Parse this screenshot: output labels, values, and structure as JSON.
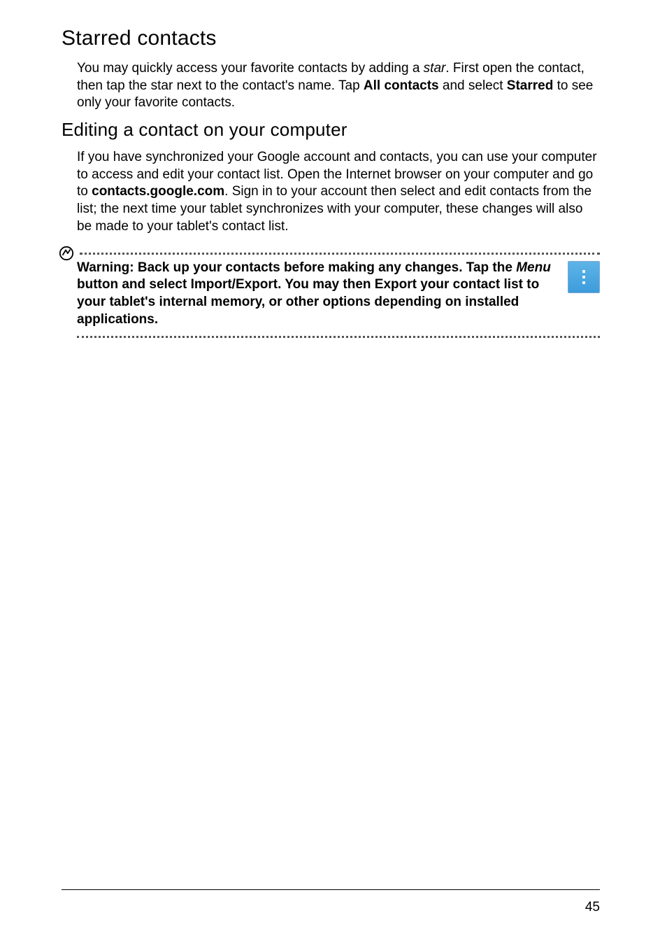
{
  "section1": {
    "heading": "Starred contacts",
    "p1_a": "You may quickly access your favorite contacts by adding a ",
    "p1_star": "star",
    "p1_b": ". First open the contact, then tap the star next to the contact's name. Tap ",
    "p1_all": "All contacts",
    "p1_c": "  and select ",
    "p1_starred": "Starred",
    "p1_d": " to see only your favorite contacts."
  },
  "section2": {
    "heading": "Editing a contact on your computer",
    "p1_a": "If you have synchronized your Google account and contacts, you can use your computer to access and edit your contact list. Open the Internet browser on your computer and go to ",
    "p1_url": "contacts.google.com",
    "p1_b": ". Sign in to your account then select and edit contacts from the list; the next time your tablet synchronizes with your computer, these changes will also be made to your tablet's contact list."
  },
  "warning": {
    "t1": "Warning: Back up your contacts before making any changes. Tap the ",
    "menu": "Menu",
    "t2": " button and select Import/Export. You may then Export your contact list to your tablet's internal memory, or other options depending on installed applications."
  },
  "page_number": "45"
}
